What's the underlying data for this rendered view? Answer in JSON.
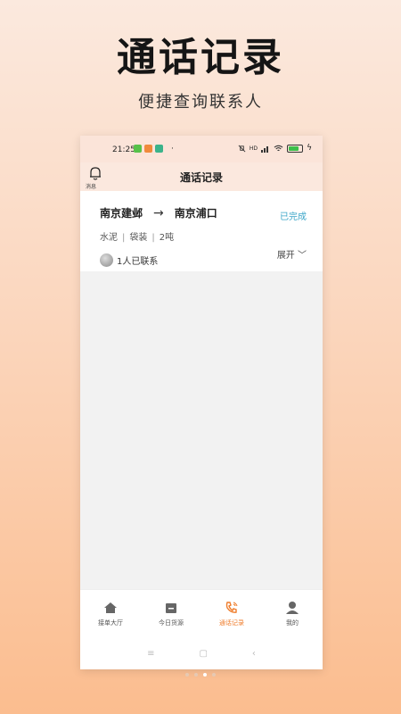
{
  "promo": {
    "title": "通话记录",
    "subtitle": "便捷查询联系人"
  },
  "status_bar": {
    "time": "21:25",
    "dot": "·",
    "wifi_label": "HD",
    "battery_label": "70"
  },
  "header": {
    "bell_label": "消息",
    "title": "通话记录"
  },
  "record": {
    "from": "南京建邺",
    "arrow": "→",
    "to": "南京浦口",
    "status": "已完成",
    "cargo": [
      "水泥",
      "袋装",
      "2吨"
    ],
    "cargo_sep": "|",
    "contacts": "1人已联系",
    "expand": "展开 ﹀"
  },
  "tabs": [
    {
      "label": "接单大厅",
      "icon": "home-icon"
    },
    {
      "label": "今日货源",
      "icon": "cargo-box-icon"
    },
    {
      "label": "通话记录",
      "icon": "phone-icon"
    },
    {
      "label": "我的",
      "icon": "user-icon"
    }
  ],
  "nav": {
    "menu": "≡",
    "home": "▢",
    "back": "‹"
  },
  "colors": {
    "accent": "#ef7d2c",
    "status_done": "#3ba5c8"
  }
}
